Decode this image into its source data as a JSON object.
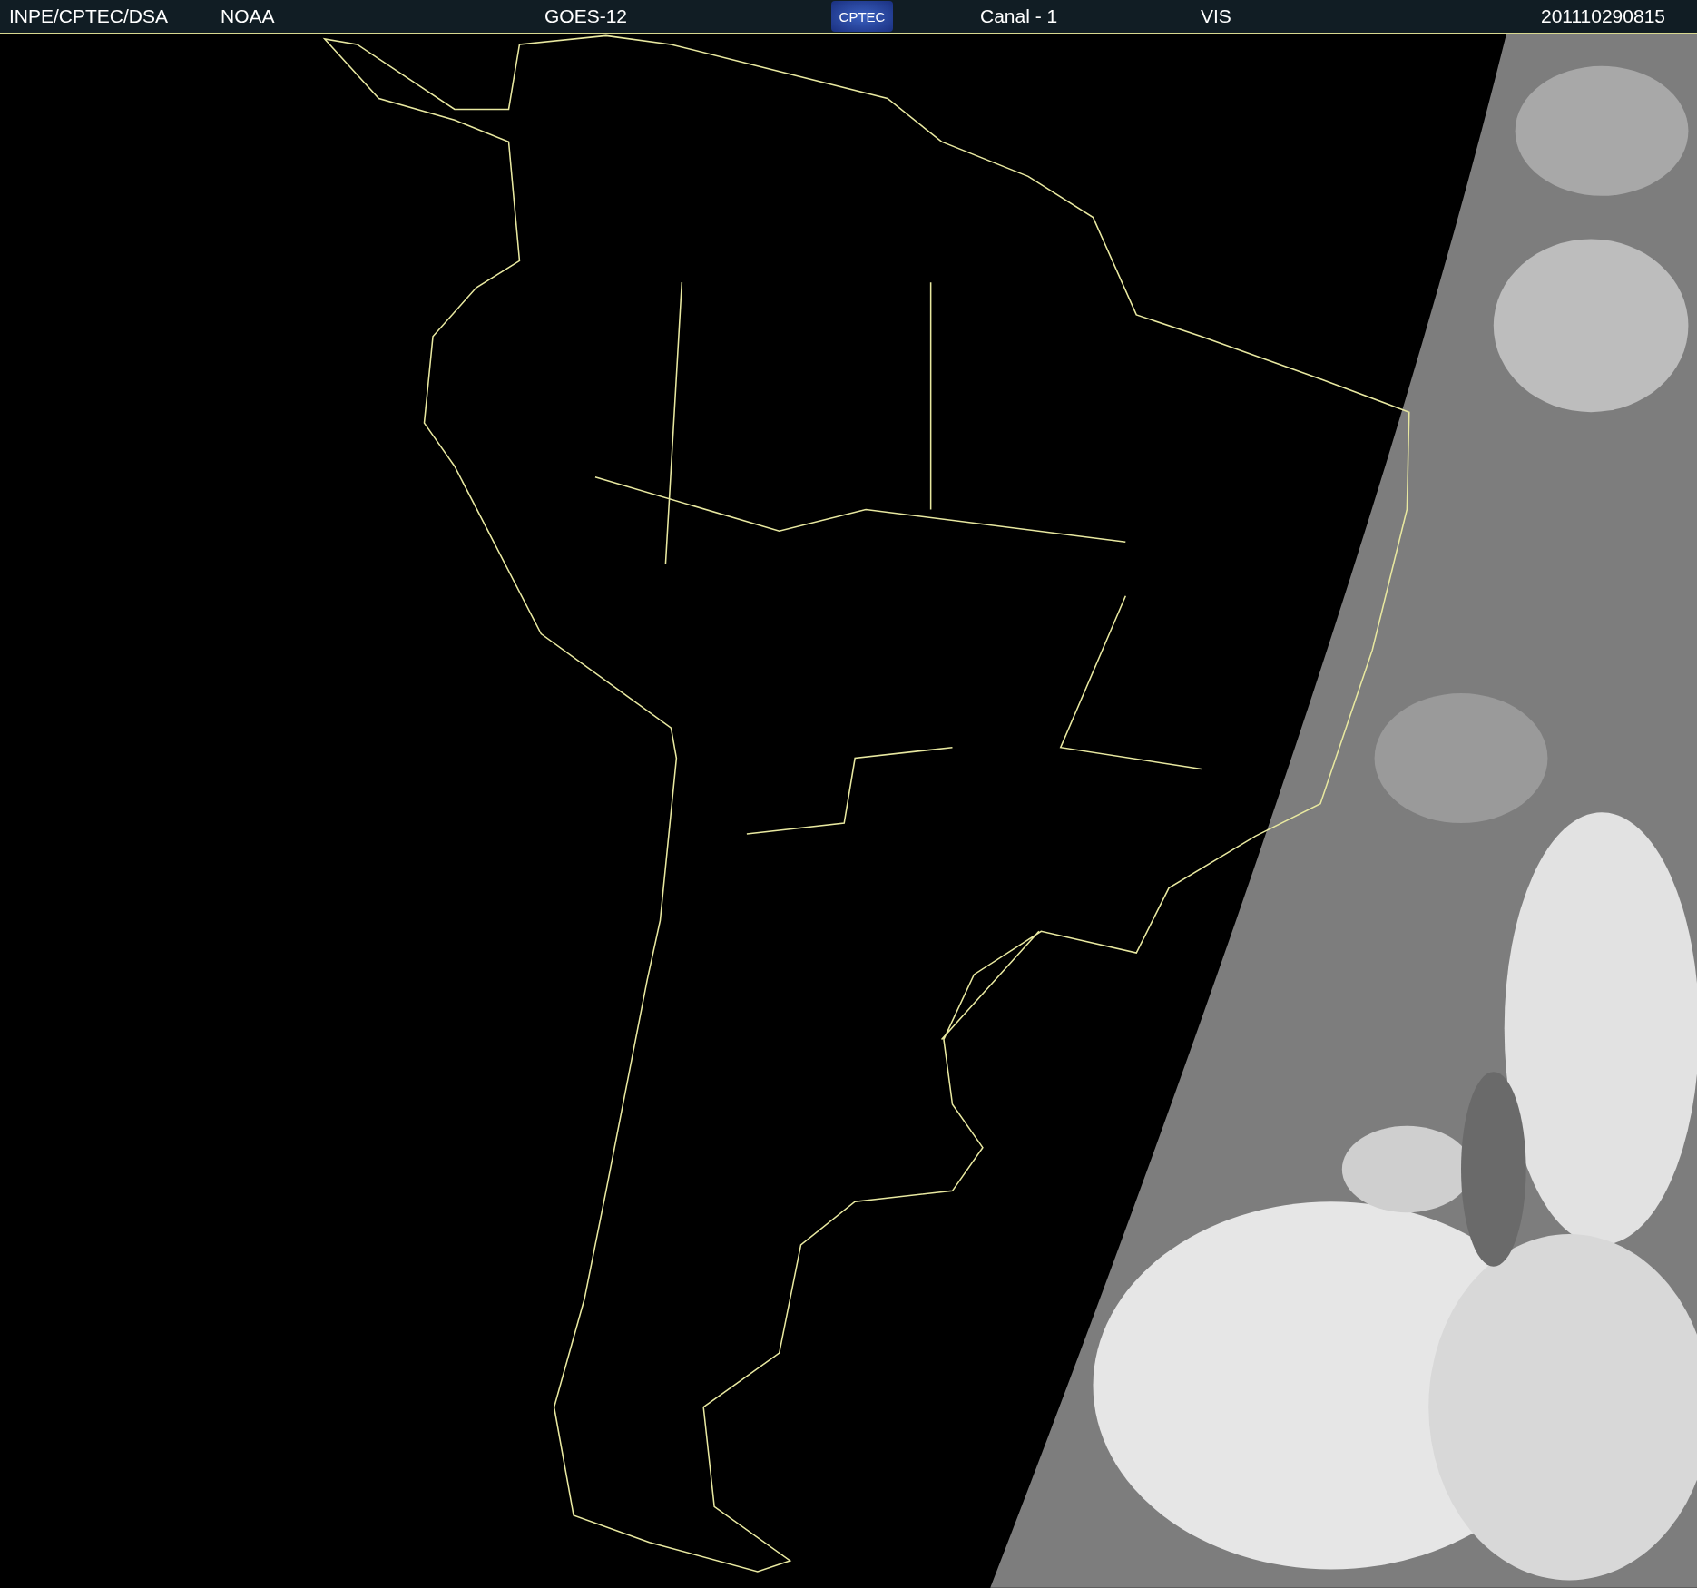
{
  "header": {
    "labels": [
      "INPE/CPTEC/DSA",
      "NOAA",
      "GOES-12"
    ],
    "logo": "CPTEC",
    "channel": "Canal - 1",
    "band": "VIS",
    "timestamp": "201110290815"
  }
}
